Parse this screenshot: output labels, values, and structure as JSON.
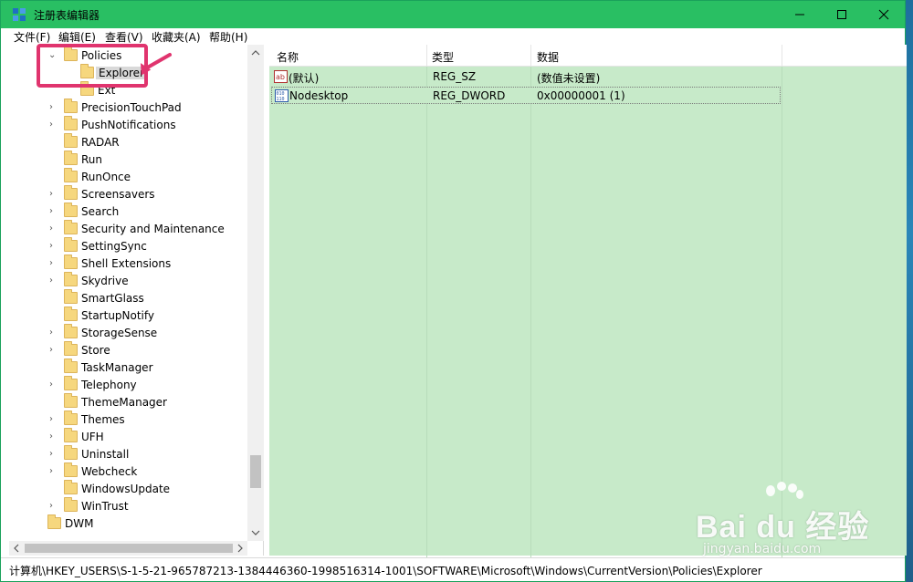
{
  "window": {
    "title": "注册表编辑器",
    "controls": {
      "minimize": "—",
      "maximize": "☐",
      "close": "✕"
    }
  },
  "menu": {
    "items": [
      {
        "label": "文件(F)"
      },
      {
        "label": "编辑(E)"
      },
      {
        "label": "查看(V)"
      },
      {
        "label": "收藏夹(A)"
      },
      {
        "label": "帮助(H)"
      }
    ]
  },
  "tree": {
    "items": [
      {
        "label": "Policies",
        "expanded": true,
        "icon": "folder-icon"
      },
      {
        "label": "Explorer",
        "selected": true,
        "icon": "folder-icon"
      },
      {
        "label": "Ext",
        "icon": "folder-icon"
      },
      {
        "label": "PrecisionTouchPad",
        "collapsible": true,
        "icon": "folder-icon"
      },
      {
        "label": "PushNotifications",
        "collapsible": true,
        "icon": "folder-icon"
      },
      {
        "label": "RADAR",
        "icon": "folder-icon"
      },
      {
        "label": "Run",
        "icon": "folder-icon"
      },
      {
        "label": "RunOnce",
        "icon": "folder-icon"
      },
      {
        "label": "Screensavers",
        "collapsible": true,
        "icon": "folder-icon"
      },
      {
        "label": "Search",
        "collapsible": true,
        "icon": "folder-icon"
      },
      {
        "label": "Security and Maintenance",
        "collapsible": true,
        "icon": "folder-icon"
      },
      {
        "label": "SettingSync",
        "collapsible": true,
        "icon": "folder-icon"
      },
      {
        "label": "Shell Extensions",
        "collapsible": true,
        "icon": "folder-icon"
      },
      {
        "label": "Skydrive",
        "collapsible": true,
        "icon": "folder-icon"
      },
      {
        "label": "SmartGlass",
        "icon": "folder-icon"
      },
      {
        "label": "StartupNotify",
        "icon": "folder-icon"
      },
      {
        "label": "StorageSense",
        "collapsible": true,
        "icon": "folder-icon"
      },
      {
        "label": "Store",
        "collapsible": true,
        "icon": "folder-icon"
      },
      {
        "label": "TaskManager",
        "icon": "folder-icon"
      },
      {
        "label": "Telephony",
        "collapsible": true,
        "icon": "folder-icon"
      },
      {
        "label": "ThemeManager",
        "icon": "folder-icon"
      },
      {
        "label": "Themes",
        "collapsible": true,
        "icon": "folder-icon"
      },
      {
        "label": "UFH",
        "collapsible": true,
        "icon": "folder-icon"
      },
      {
        "label": "Uninstall",
        "collapsible": true,
        "icon": "folder-icon"
      },
      {
        "label": "Webcheck",
        "collapsible": true,
        "icon": "folder-icon"
      },
      {
        "label": "WindowsUpdate",
        "icon": "folder-icon"
      },
      {
        "label": "WinTrust",
        "collapsible": true,
        "icon": "folder-icon"
      },
      {
        "label": "DWM",
        "icon": "folder-icon"
      }
    ]
  },
  "list": {
    "columns": {
      "name": "名称",
      "type": "类型",
      "data": "数据"
    },
    "rows": [
      {
        "name": "(默认)",
        "type": "REG_SZ",
        "data": "(数值未设置)",
        "icon": "string-value-icon"
      },
      {
        "name": "Nodesktop",
        "type": "REG_DWORD",
        "data": "0x00000001 (1)",
        "icon": "binary-value-icon",
        "selected": true
      }
    ]
  },
  "status": {
    "path": "计算机\\HKEY_USERS\\S-1-5-21-965787213-1384446360-1998516314-1001\\SOFTWARE\\Microsoft\\Windows\\CurrentVersion\\Policies\\Explorer"
  },
  "watermark": {
    "logo": "Bai du 经验",
    "site": "jingyan.baidu.com"
  },
  "colors": {
    "titlebar": "#29bf63",
    "list_background": "#c7eac9",
    "highlight": "#e0346e"
  }
}
